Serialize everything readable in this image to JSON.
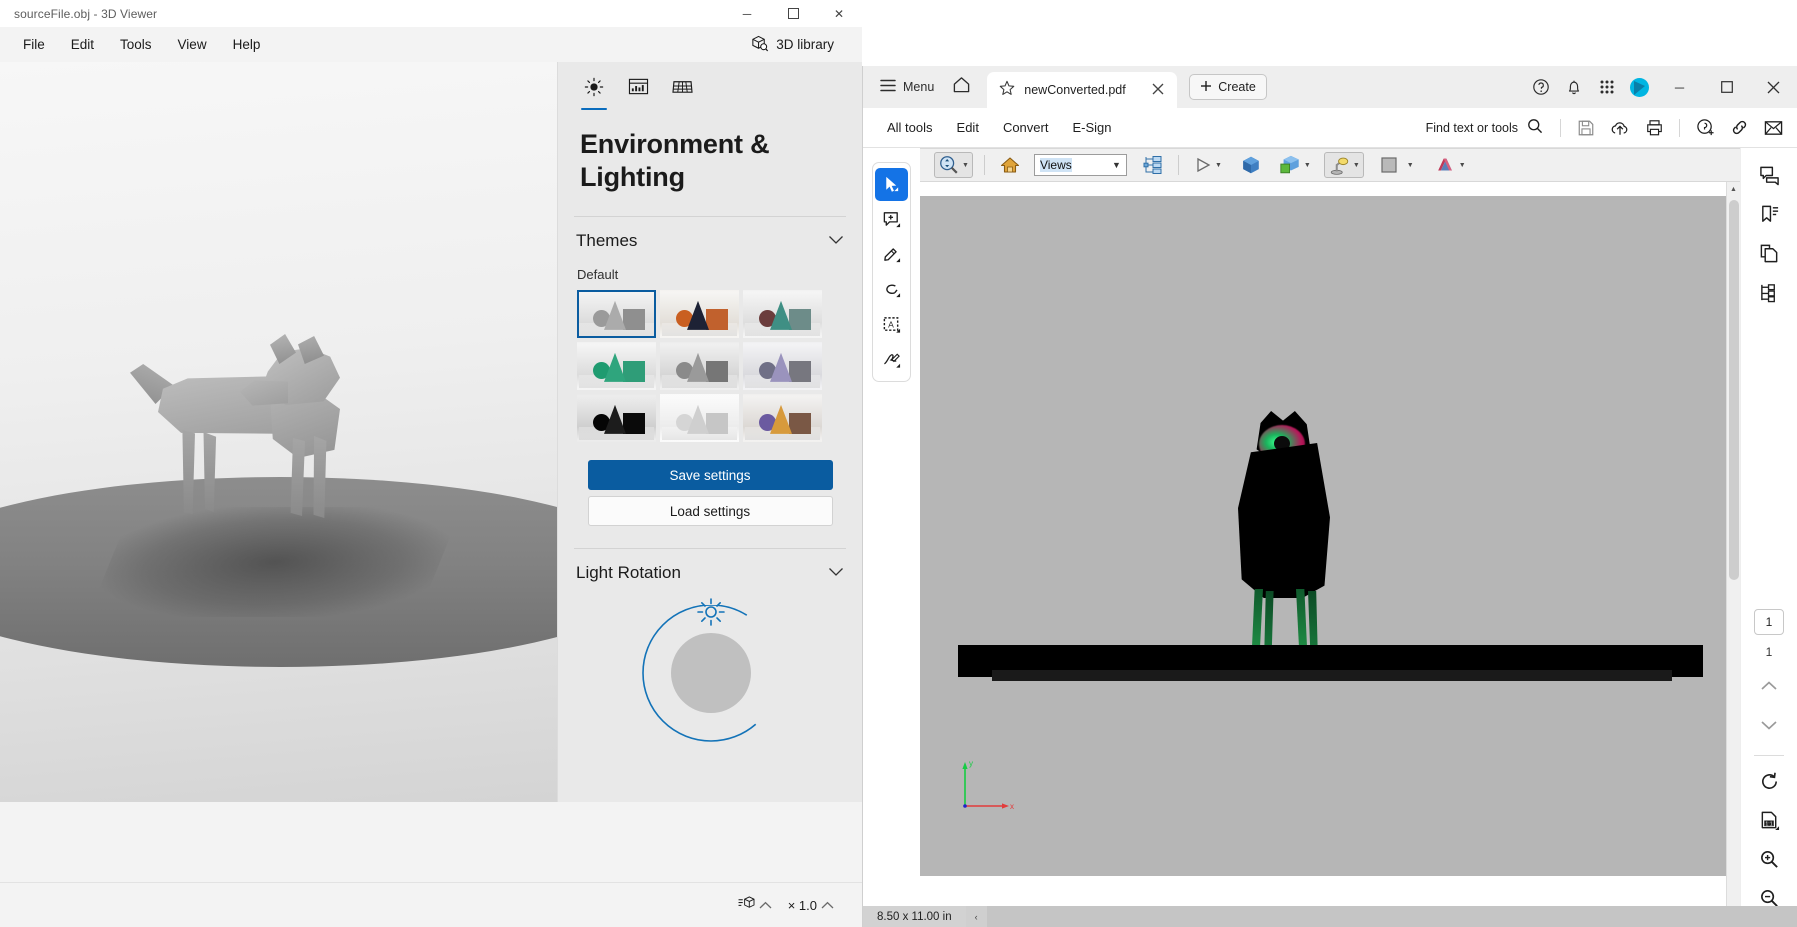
{
  "viewer3d": {
    "title": "sourceFile.obj - 3D Viewer",
    "window_buttons": [
      {
        "name": "minimize",
        "glyph": "─"
      },
      {
        "name": "maximize",
        "glyph": "☐"
      },
      {
        "name": "close",
        "glyph": "✕"
      }
    ],
    "menu": [
      "File",
      "Edit",
      "Tools",
      "View",
      "Help"
    ],
    "library_button": "3D library",
    "tabs": [
      {
        "name": "lighting",
        "icon": "sun-icon",
        "active": true
      },
      {
        "name": "animation",
        "icon": "timeline-icon",
        "active": false
      },
      {
        "name": "grid",
        "icon": "grid-icon",
        "active": false
      }
    ],
    "panel_title": "Environment & Lighting",
    "themes": {
      "section_title": "Themes",
      "group_label": "Default",
      "selected_index": 0,
      "swatches": [
        {
          "name": "default-gray",
          "sphere": "#9a9a9a",
          "cone": "#ababab",
          "cube": "#8f8f8f",
          "bg_top": "#f4f4f4",
          "bg_bottom": "#dcdcdc"
        },
        {
          "name": "warm-orange",
          "sphere": "#c95f21",
          "cone": "#1d2235",
          "cube": "#c1612d",
          "bg_top": "#f6f5f3",
          "bg_bottom": "#e3dfd9"
        },
        {
          "name": "teal-slate",
          "sphere": "#6b3d3d",
          "cone": "#3f8f84",
          "cube": "#6d8c89",
          "bg_top": "#f5f5f5",
          "bg_bottom": "#dedede"
        },
        {
          "name": "emerald",
          "sphere": "#1f9b70",
          "cone": "#2fa57d",
          "cube": "#2f9d78",
          "bg_top": "#f5f5f5",
          "bg_bottom": "#dcdcdc"
        },
        {
          "name": "neutral-dim",
          "sphere": "#8a8a8a",
          "cone": "#9a9a9a",
          "cube": "#767676",
          "bg_top": "#f0f0f0",
          "bg_bottom": "#d6d6d6"
        },
        {
          "name": "violet",
          "sphere": "#6f6f86",
          "cone": "#9a93bd",
          "cube": "#77777f",
          "bg_top": "#f3f3f5",
          "bg_bottom": "#dadade"
        },
        {
          "name": "night-black",
          "sphere": "#050505",
          "cone": "#1c1c1c",
          "cube": "#0a0a0a",
          "bg_top": "#ededed",
          "bg_bottom": "#cfcfcf"
        },
        {
          "name": "soft-white",
          "sphere": "#d5d5d5",
          "cone": "#cfcfcf",
          "cube": "#c6c6c6",
          "bg_top": "#fbfbfb",
          "bg_bottom": "#ececec"
        },
        {
          "name": "sunset",
          "sphere": "#6b5aa0",
          "cone": "#d79a3c",
          "cube": "#7a5845",
          "bg_top": "#f3f2f1",
          "bg_bottom": "#dcd8d4"
        }
      ]
    },
    "buttons": {
      "save_settings": "Save settings",
      "load_settings": "Load settings"
    },
    "light_rotation": {
      "section_title": "Light Rotation"
    },
    "status": {
      "model_button_label": "",
      "scale_label": "× 1.0",
      "chevron": "⌃"
    }
  },
  "acrobat": {
    "menu_label": "Menu",
    "tab": {
      "filename": "newConverted.pdf",
      "star_icon": "star-icon",
      "close_icon": "close-icon"
    },
    "create_button": "Create",
    "titlebar_icons": [
      "help-icon",
      "bell-icon",
      "apps-grid-icon",
      "account-avatar"
    ],
    "window_buttons": [
      {
        "name": "minimize",
        "glyph": "─"
      },
      {
        "name": "maximize",
        "glyph": "☐"
      },
      {
        "name": "close",
        "glyph": "✕"
      }
    ],
    "toolbar": {
      "items": [
        "All tools",
        "Edit",
        "Convert",
        "E-Sign"
      ],
      "find_placeholder": "Find text or tools",
      "right_icons": [
        "save-icon",
        "upload-cloud-icon",
        "print-icon",
        "add-stamp-icon",
        "link-icon",
        "email-icon"
      ]
    },
    "left_rail_tools": [
      {
        "name": "select-tool",
        "active": true
      },
      {
        "name": "comment-tool",
        "active": false
      },
      {
        "name": "highlight-tool",
        "active": false
      },
      {
        "name": "lasso-tool",
        "active": false
      },
      {
        "name": "text-select-tool",
        "active": false
      },
      {
        "name": "signature-tool",
        "active": false
      }
    ],
    "toolbar3d": {
      "rotate_tool": "zoom-tool",
      "home_icon": "home-icon",
      "views_value": "Views",
      "model_tree_icon": "model-tree-icon",
      "play_icon": "play-icon",
      "use_default_view_icon": "cube-blue-icon",
      "model_render_icon": "cube-green-icon",
      "lighting_icon": "lamp-icon",
      "background_color_icon": "color-swatch-icon",
      "cross_section_icon": "cross-section-icon"
    },
    "right_rail_tools": [
      {
        "name": "comments-panel"
      },
      {
        "name": "bookmarks-panel"
      },
      {
        "name": "page-thumbnails-panel"
      },
      {
        "name": "layers-panel"
      }
    ],
    "page_nav": {
      "current_page": "1",
      "total_pages": "1",
      "up_glyph": "⌃",
      "down_glyph": "⌄"
    },
    "right_rail_bottom": [
      {
        "name": "rotate-page-icon"
      },
      {
        "name": "fit-page-icon"
      },
      {
        "name": "zoom-in-icon"
      },
      {
        "name": "zoom-out-icon"
      }
    ],
    "status": {
      "page_size": "8.50 x 11.00 in",
      "scroll_left_glyph": "‹"
    },
    "colors": {
      "accent_blue": "#1473e6",
      "avatar_cyan": "#00b5e2",
      "canvas_gray": "#b6b6b6"
    }
  }
}
